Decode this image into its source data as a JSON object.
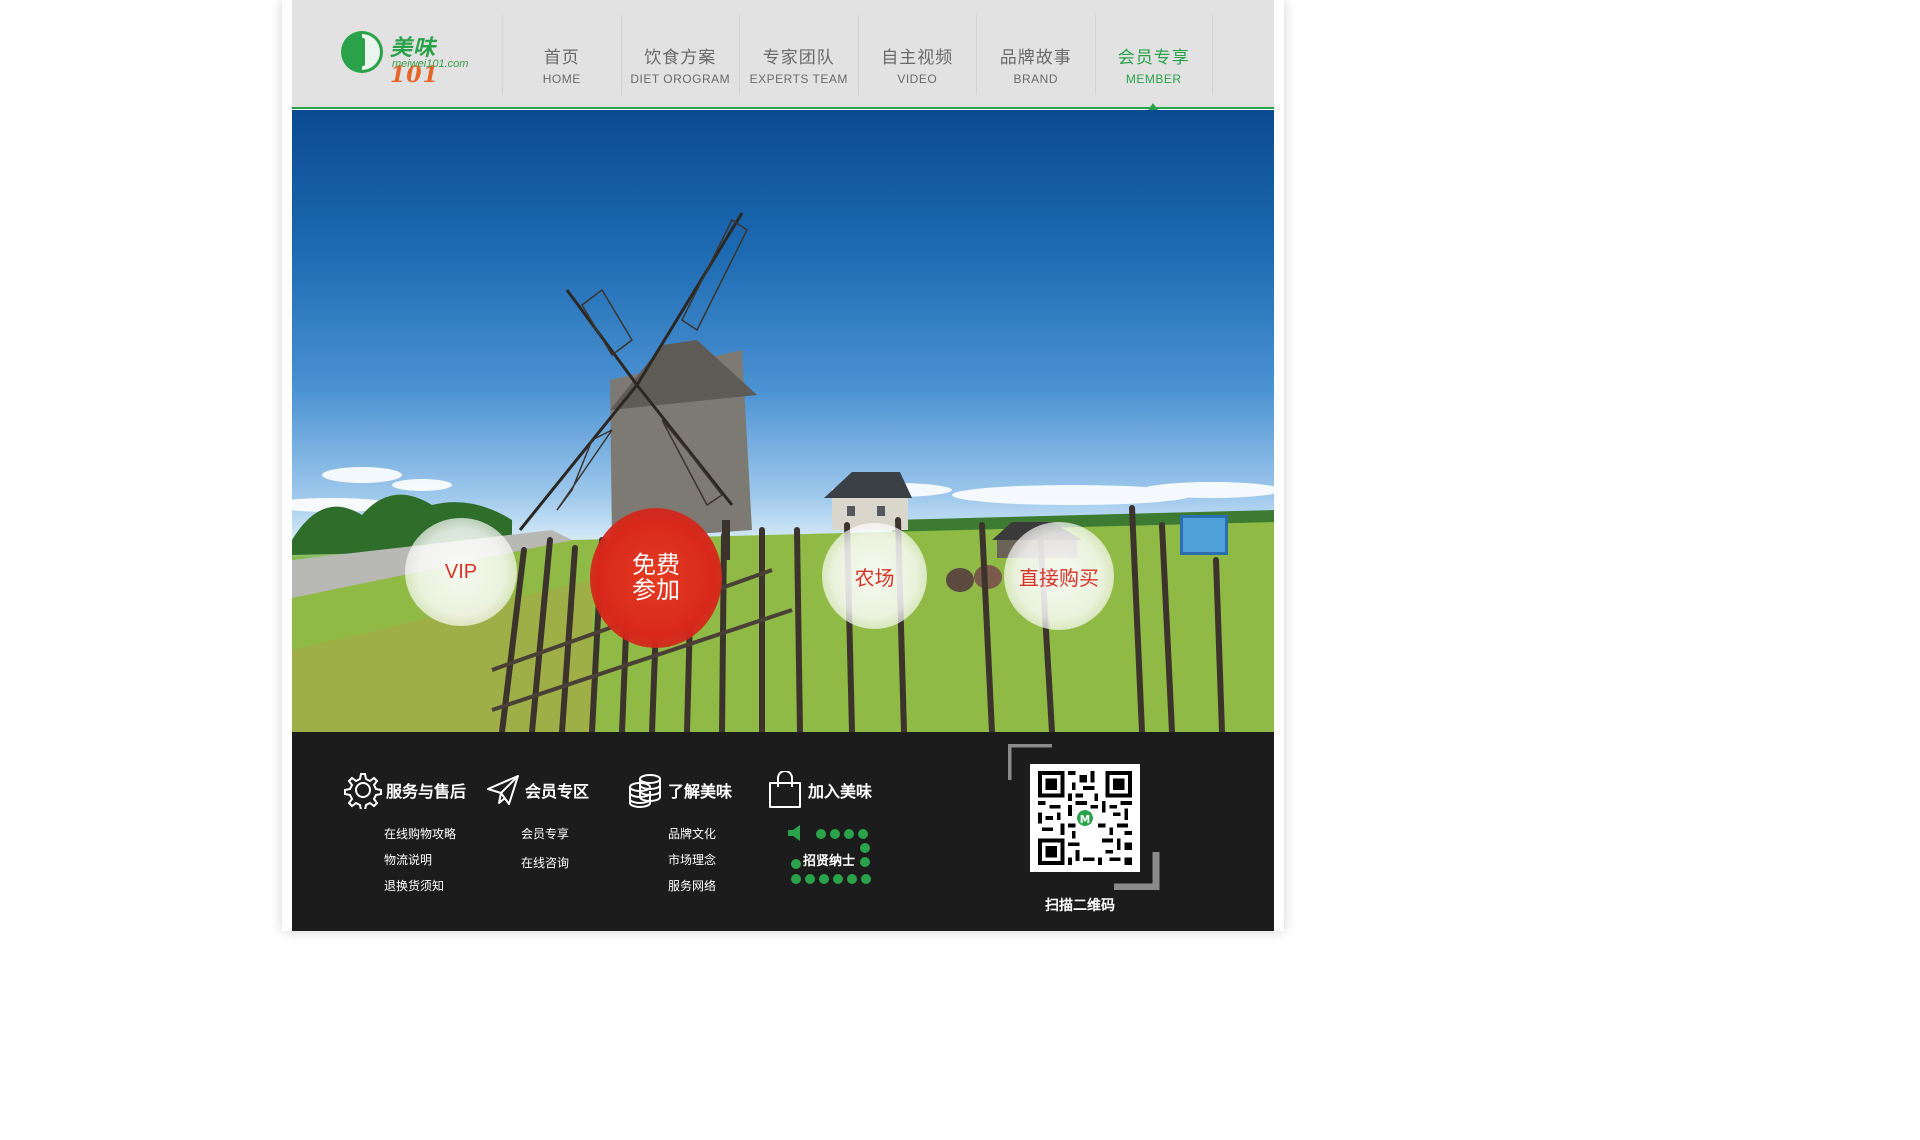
{
  "brand": {
    "logo_cn_text": "美味",
    "logo_cn_number": "101",
    "logo_en": "meiwei101.com",
    "accent_color": "#2aa24a"
  },
  "nav": {
    "items": [
      {
        "cn": "首页",
        "en": "HOME",
        "active": false
      },
      {
        "cn": "饮食方案",
        "en": "DIET OROGRAM",
        "active": false
      },
      {
        "cn": "专家团队",
        "en": "EXPERTS TEAM",
        "active": false
      },
      {
        "cn": "自主视频",
        "en": "VIDEO",
        "active": false
      },
      {
        "cn": "品牌故事",
        "en": "BRAND",
        "active": false
      },
      {
        "cn": "会员专享",
        "en": "MEMBER",
        "active": true
      }
    ]
  },
  "hero": {
    "bubbles": {
      "vip": "VIP",
      "free_line1": "免费",
      "free_line2": "参加",
      "farm": "农场",
      "buy": "直接购买"
    }
  },
  "footer": {
    "columns": [
      {
        "icon": "gear-icon",
        "title": "服务与售后",
        "links": [
          "在线购物攻略",
          "物流说明",
          "退换货须知"
        ]
      },
      {
        "icon": "paper-plane-icon",
        "title": "会员专区",
        "links": [
          "会员专享",
          "在线咨询"
        ]
      },
      {
        "icon": "coin-stack-icon",
        "title": "了解美味",
        "links": [
          "品牌文化",
          "市场理念",
          "服务网络"
        ]
      },
      {
        "icon": "shopping-bag-icon",
        "title": "加入美味",
        "links": []
      }
    ],
    "recruit_label": "招贤纳士",
    "qr_label": "扫描二维码"
  }
}
